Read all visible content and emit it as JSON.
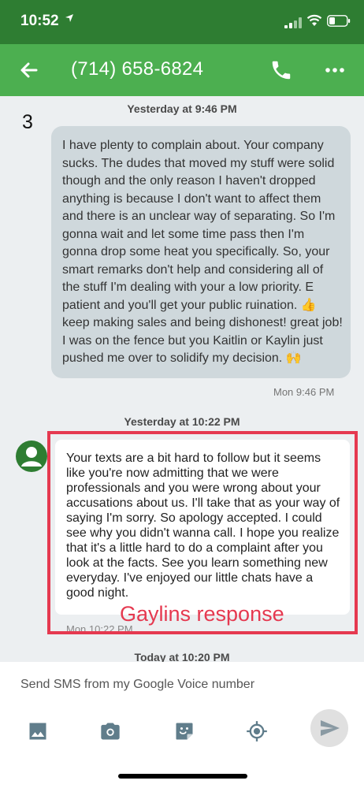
{
  "status_bar": {
    "time": "10:52",
    "icons": [
      "location-arrow-icon",
      "signal-icon",
      "wifi-icon",
      "battery-icon"
    ]
  },
  "app_bar": {
    "title": "(714) 658-6824",
    "icons": [
      "back-arrow-icon",
      "phone-icon",
      "more-icon"
    ]
  },
  "colors": {
    "status_bar": "#2e7d32",
    "app_bar": "#4caf50",
    "incoming_bubble": "#cfd8dc",
    "annotation": "#e53950"
  },
  "conversation": {
    "badge": "3",
    "messages": [
      {
        "header": "Yesterday at 9:46 PM",
        "body": "I have plenty to complain about. Your company sucks. The dudes that moved my stuff were solid though and the only reason I haven't dropped anything is because I don't want to affect them and there is an unclear way of separating. So I'm gonna wait and let some time pass then I'm gonna drop some heat you specifically. So, your smart remarks don't help and considering all of the stuff I'm dealing with your a low priority.  E patient and you'll get your public ruination. 👍 keep making sales and being dishonest! great job! I was on the fence but you Kaitlin or Kaylin just pushed me over to solidify my decision. 🙌",
        "meta": "Mon 9:46 PM"
      },
      {
        "header": "Yesterday at 10:22 PM",
        "body": "Your texts are a bit hard to follow but it seems like you're now admitting that we were professionals and you were wrong about your accusations about us.  I'll take that as your way of saying I'm sorry.   So apology accepted.    I could see why you didn't wanna call.  I hope you realize that it's a little hard to do a complaint after you look at the facts.  See you learn something new everyday.  I've enjoyed our little chats have a good night.",
        "meta": "Mon 10:22 PM"
      }
    ],
    "next_header": "Today at 10:20 PM",
    "annotation": "Gaylins response"
  },
  "composer": {
    "placeholder": "Send SMS from my Google Voice number",
    "tools": [
      "image-icon",
      "camera-icon",
      "sticker-icon",
      "location-icon",
      "send-icon"
    ]
  }
}
